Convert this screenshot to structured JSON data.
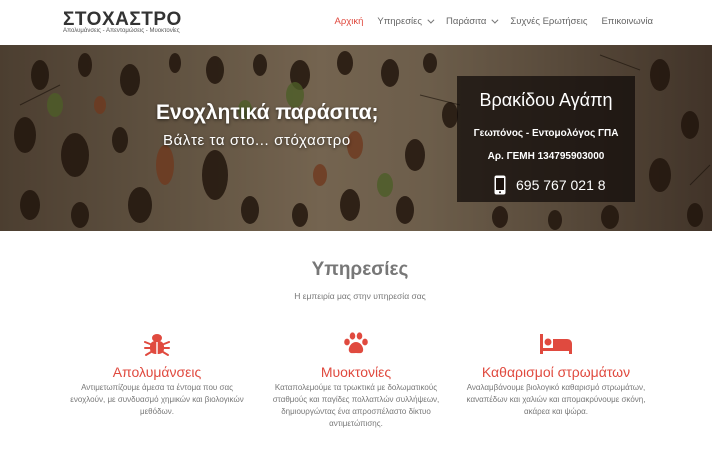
{
  "logo": {
    "title": "ΣΤΟΧΑΣΤΡΟ",
    "tagline": "Απολυμάνσεις - Απεντομώσεις - Μυοκτονίες"
  },
  "nav": {
    "items": [
      {
        "label": "Αρχική",
        "active": true
      },
      {
        "label": "Υπηρεσίες",
        "has_dropdown": true
      },
      {
        "label": "Παράσιτα",
        "has_dropdown": true
      },
      {
        "label": "Συχνές Ερωτήσεις"
      },
      {
        "label": "Επικοινωνία"
      }
    ]
  },
  "hero": {
    "title": "Ενοχλητικά παράσιτα;",
    "subtitle": "Βάλτε τα στο... στόχαστρο"
  },
  "card": {
    "name": "Βρακίδου Αγάπη",
    "role": "Γεωπόνος - Εντομολόγος  ΓΠΑ",
    "registry": "Αρ. ΓΕΜΗ 134795903000",
    "phone": "695 767 021 8"
  },
  "services": {
    "title": "Υπηρεσίες",
    "subtitle": "Η εμπειρία μας στην υπηρεσία σας",
    "items": [
      {
        "icon": "bug-icon",
        "name": "Απολυμάνσεις",
        "description": "Αντιμετωπίζουμε άμεσα τα έντομα που σας ενοχλούν, με συνδυασμό χημικών και βιολογικών μεθόδων."
      },
      {
        "icon": "paw-icon",
        "name": "Μυοκτονίες",
        "description": "Καταπολεμούμε τα τρωκτικά με δολωματικούς σταθμούς και παγίδες πολλαπλών συλλήψεων, δημιουργώντας ένα απροσπέλαστο δίκτυο αντιμετώπισης."
      },
      {
        "icon": "bed-icon",
        "name": "Καθαρισμοί στρωμάτων",
        "description": "Αναλαμβάνουμε βιολογικό καθαρισμό στρωμάτων, καναπέδων και χαλιών και απομακρύνουμε σκόνη, ακάρεα και ψώρα."
      }
    ]
  },
  "colors": {
    "accent": "#e04a3f",
    "text": "#777777"
  }
}
